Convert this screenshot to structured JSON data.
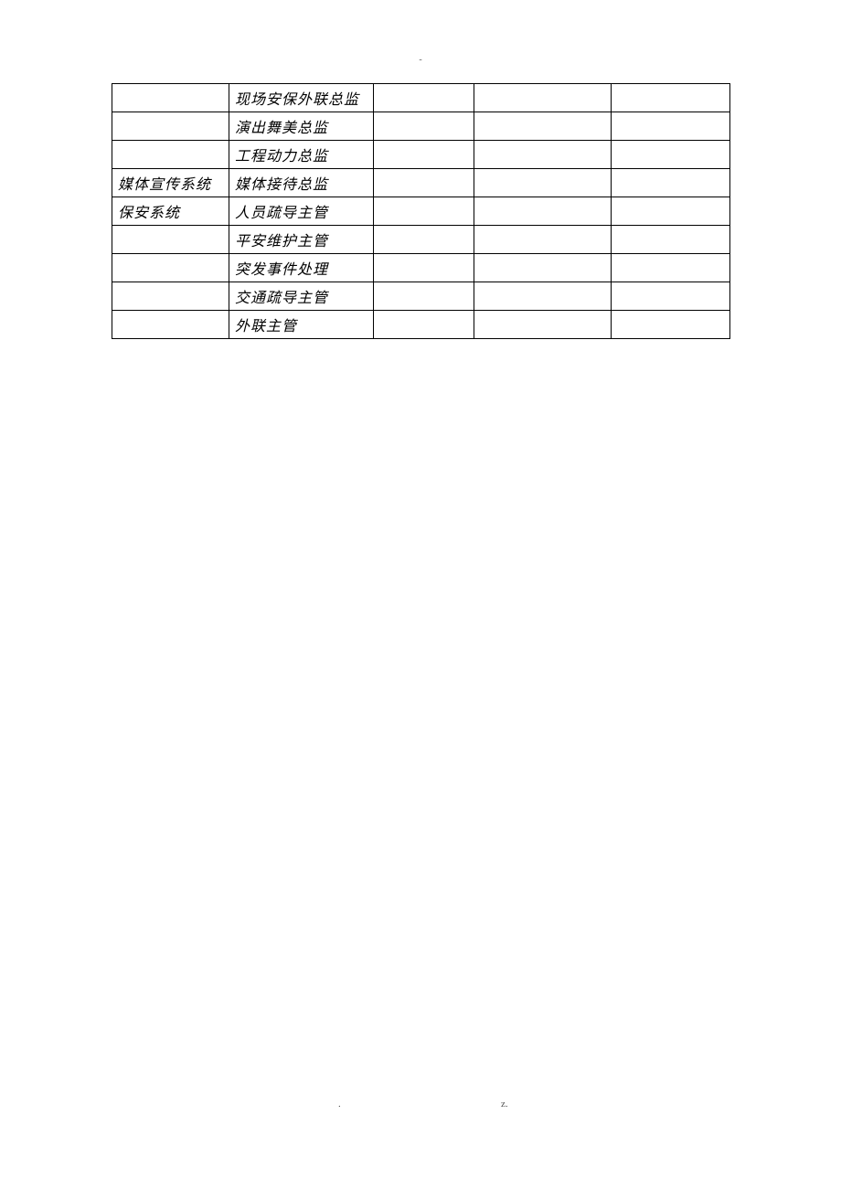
{
  "header_mark": "-",
  "table": {
    "rows": [
      {
        "col1": "",
        "col2": "现场安保外联总监",
        "col3": "",
        "col4": "",
        "col5": ""
      },
      {
        "col1": "",
        "col2": "演出舞美总监",
        "col3": "",
        "col4": "",
        "col5": ""
      },
      {
        "col1": "",
        "col2": "工程动力总监",
        "col3": "",
        "col4": "",
        "col5": ""
      },
      {
        "col1": "媒体宣传系统",
        "col2": "媒体接待总监",
        "col3": "",
        "col4": "",
        "col5": ""
      },
      {
        "col1": "保安系统",
        "col2": "人员疏导主管",
        "col3": "",
        "col4": "",
        "col5": ""
      },
      {
        "col1": "",
        "col2": "平安维护主管",
        "col3": "",
        "col4": "",
        "col5": ""
      },
      {
        "col1": "",
        "col2": "突发事件处理",
        "col3": "",
        "col4": "",
        "col5": ""
      },
      {
        "col1": "",
        "col2": "交通疏导主管",
        "col3": "",
        "col4": "",
        "col5": ""
      },
      {
        "col1": "",
        "col2": "外联主管",
        "col3": "",
        "col4": "",
        "col5": ""
      }
    ]
  },
  "footer_left": ".",
  "footer_right": "z."
}
